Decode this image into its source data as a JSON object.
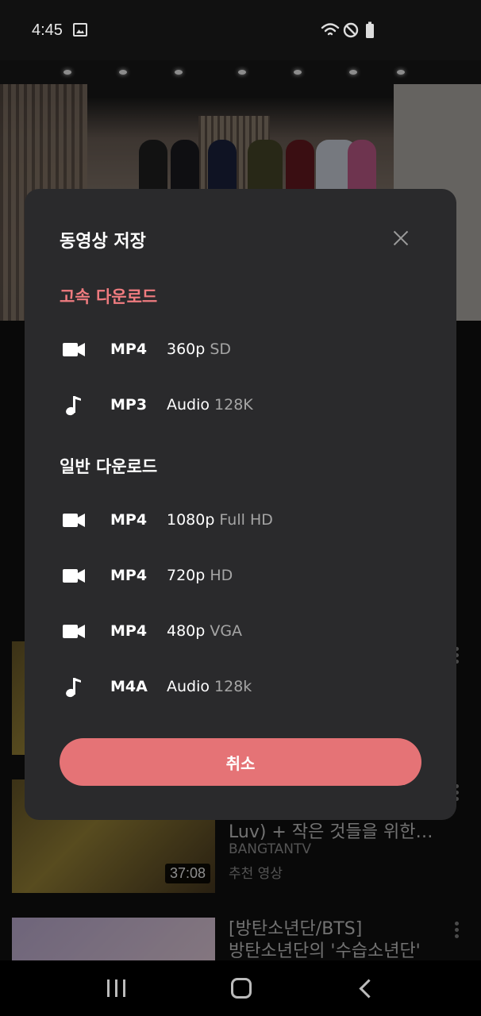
{
  "status_bar": {
    "time": "4:45"
  },
  "background": {
    "list_item_2": {
      "title_line": "Luv) + 작은 것들을 위한…",
      "channel": "BANGTANTV",
      "meta": "추천 영상",
      "duration": "37:08"
    },
    "list_item_3": {
      "title_line_1": "[방탄소년단/BTS]",
      "title_line_2": "방탄소년단의 '수습소년단'"
    }
  },
  "modal": {
    "title": "동영상 저장",
    "fast_section": {
      "title": "고속 다운로드",
      "items": [
        {
          "icon": "video-camera-icon",
          "format": "MP4",
          "quality": "360p",
          "sub": "SD"
        },
        {
          "icon": "music-note-icon",
          "format": "MP3",
          "quality": "Audio",
          "sub": "128K"
        }
      ]
    },
    "normal_section": {
      "title": "일반 다운로드",
      "items": [
        {
          "icon": "video-camera-icon",
          "format": "MP4",
          "quality": "1080p",
          "sub": "Full HD"
        },
        {
          "icon": "video-camera-icon",
          "format": "MP4",
          "quality": "720p",
          "sub": "HD"
        },
        {
          "icon": "video-camera-icon",
          "format": "MP4",
          "quality": "480p",
          "sub": "VGA"
        },
        {
          "icon": "music-note-icon",
          "format": "M4A",
          "quality": "Audio",
          "sub": "128k"
        }
      ]
    },
    "cancel_label": "취소"
  },
  "colors": {
    "accent": "#e57376",
    "section_fast": "#ef7b7f",
    "modal_bg": "#2a2a2c"
  }
}
